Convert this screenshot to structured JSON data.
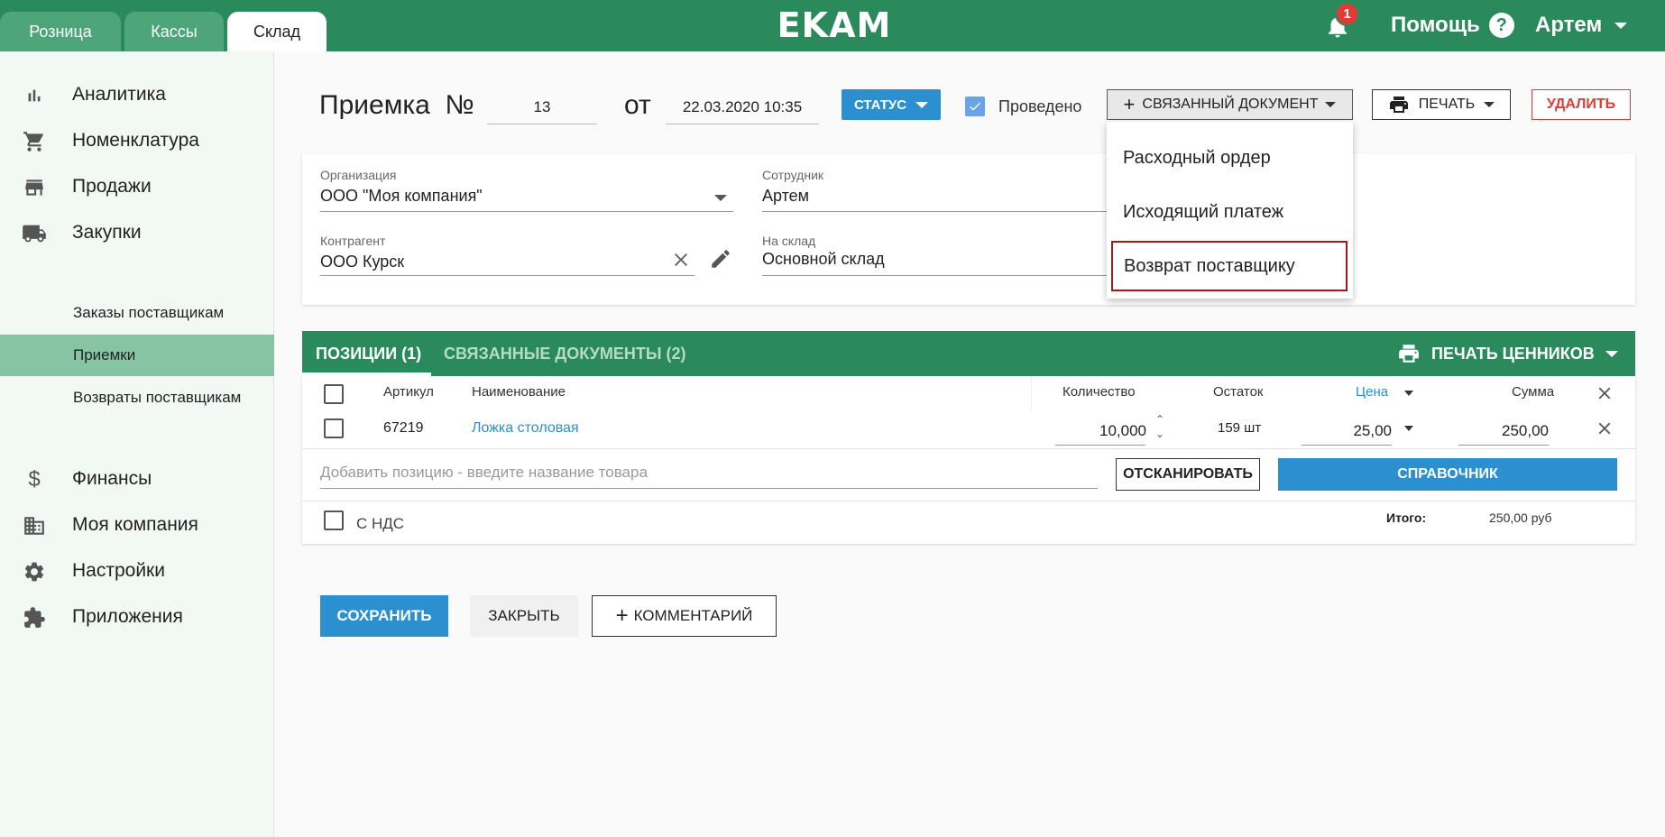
{
  "topbar": {
    "tabs": [
      {
        "label": "Розница"
      },
      {
        "label": "Кассы"
      },
      {
        "label": "Склад"
      }
    ],
    "logo": "EKAM",
    "notifications_count": "1",
    "help_label": "Помощь",
    "help_glyph": "?",
    "user_name": "Артем"
  },
  "sidebar": {
    "items": [
      {
        "label": "Аналитика",
        "icon": "bar-chart-icon"
      },
      {
        "label": "Номенклатура",
        "icon": "cart-icon"
      },
      {
        "label": "Продажи",
        "icon": "store-icon"
      },
      {
        "label": "Закупки",
        "icon": "truck-icon"
      },
      {
        "label": "Финансы",
        "icon": "dollar-icon"
      },
      {
        "label": "Моя компания",
        "icon": "building-icon"
      },
      {
        "label": "Настройки",
        "icon": "gear-icon"
      },
      {
        "label": "Приложения",
        "icon": "puzzle-icon"
      }
    ],
    "sub_items": [
      {
        "label": "Заказы поставщикам"
      },
      {
        "label": "Приемки"
      },
      {
        "label": "Возвраты поставщикам"
      }
    ]
  },
  "header": {
    "title": "Приемка  №",
    "number": "13",
    "from_label": "от",
    "date": "22.03.2020 10:35",
    "status_label": "СТАТУС",
    "posted_label": "Проведено",
    "related_label": "СВЯЗАННЫЙ ДОКУМЕНТ",
    "print_label": "ПЕЧАТЬ",
    "delete_label": "УДАЛИТЬ"
  },
  "form": {
    "org_label": "Организация",
    "org_value": "ООО \"Моя компания\"",
    "employee_label": "Сотрудник",
    "employee_value": "Артем",
    "counterparty_label": "Контрагент",
    "counterparty_value": "ООО Курск",
    "warehouse_label": "На склад",
    "warehouse_value": "Основной склад"
  },
  "dropdown": {
    "items": [
      {
        "label": "Расходный ордер"
      },
      {
        "label": "Исходящий платеж"
      },
      {
        "label": "Возврат поставщику"
      }
    ]
  },
  "table": {
    "tabs": [
      {
        "label": "ПОЗИЦИИ (1)"
      },
      {
        "label": "СВЯЗАННЫЕ ДОКУМЕНТЫ (2)"
      }
    ],
    "print_tags_label": "ПЕЧАТЬ ЦЕННИКОВ",
    "columns": {
      "sku": "Артикул",
      "name": "Наименование",
      "qty": "Количество",
      "stock": "Остаток",
      "price": "Цена",
      "sum": "Сумма"
    },
    "rows": [
      {
        "sku": "67219",
        "name": "Ложка столовая",
        "qty": "10,000",
        "stock": "159 шт",
        "price": "25,00",
        "sum": "250,00"
      }
    ],
    "add_placeholder": "Добавить позицию - введите название товара",
    "scan_label": "ОТСКАНИРОВАТЬ",
    "ref_label": "СПРАВОЧНИК",
    "vat_label": "С НДС",
    "total_label": "Итого:",
    "total_value": "250,00 руб"
  },
  "actions": {
    "save_label": "СОХРАНИТЬ",
    "close_label": "ЗАКРЫТЬ",
    "comment_label": "КОММЕНТАРИЙ"
  },
  "colors": {
    "brand_green": "#2a8a5b",
    "accent_blue": "#2b8fd0",
    "danger_red": "#e53935",
    "sidebar_active": "#86c4a3"
  }
}
